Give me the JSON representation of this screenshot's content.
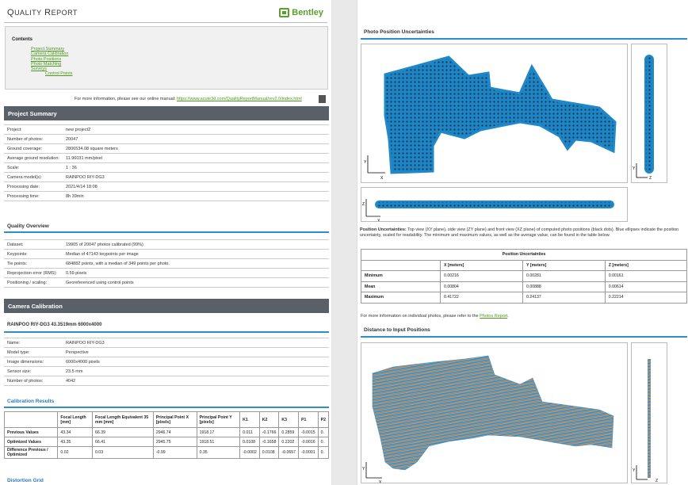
{
  "header": {
    "title_big_Q": "Q",
    "title_rest_1": "UALITY",
    "title_big_R": "R",
    "title_rest_2": "EPORT",
    "brand": "Bentley"
  },
  "contents": {
    "heading": "Contents",
    "items": [
      "Project Summary",
      "Camera Calibration",
      "Photo Positions",
      "Photo Matching",
      "Surveys"
    ],
    "subitem": "Control Points"
  },
  "manual": {
    "text": "For more information, please see our online manual: ",
    "link": "https://www.acute3d.com/QualityReportManual/rev2.0/index.html"
  },
  "project_summary": {
    "heading": "Project Summary",
    "rows": [
      [
        "Project:",
        "new project2"
      ],
      [
        "Number of photos:",
        "20047"
      ],
      [
        "Ground coverage:",
        "2806534.08 square meters"
      ],
      [
        "Average ground resolution:",
        "11.96031 mm/pixel"
      ],
      [
        "Scale:",
        "1 : 36"
      ],
      [
        "Camera model(s):",
        "RAINPOO RIY-DG3"
      ],
      [
        "Processing date:",
        "2021/4/14 18:08"
      ],
      [
        "Processing time:",
        "8h 39min"
      ]
    ]
  },
  "quality_overview": {
    "heading": "Quality Overview",
    "rows": [
      [
        "Dataset:",
        "19905 of 20047 photos calibrated (99%)"
      ],
      [
        "Keypoints:",
        "Median of 47143 keypoints per image"
      ],
      [
        "Tie points:",
        "684882 points, with a median of 349 points per photo."
      ],
      [
        "Reprojection error (RMS):",
        "0.59 pixels"
      ],
      [
        "Positioning / scaling:",
        "Georeferenced using control points"
      ]
    ]
  },
  "camera_calibration": {
    "heading": "Camera Calibration",
    "model_title": "RAINPOO RIY-DG3 43.3519mm 6000x4000",
    "rows": [
      [
        "Name:",
        "RAINPOO RIY-DG3"
      ],
      [
        "Model type:",
        "Perspective"
      ],
      [
        "Image dimensions:",
        "6000x4000 pixels"
      ],
      [
        "Sensor size:",
        "23.5 mm"
      ],
      [
        "Number of photos:",
        "4042"
      ]
    ],
    "results_heading": "Calibration Results",
    "table_headers": [
      "",
      "Focal Length [mm]",
      "Focal Length Equivalent 35 mm [mm]",
      "Principal Point X [pixels]",
      "Principal Point Y [pixels]",
      "K1",
      "K2",
      "K3",
      "P1",
      "P2"
    ],
    "table_rows": [
      [
        "Previous Values",
        "43.34",
        "66.39",
        "2946.74",
        "1918.17",
        "0.011",
        "-0.1766",
        "0.2859",
        "-0.0015",
        "0."
      ],
      [
        "Optimized Values",
        "43.35",
        "66.41",
        "2945.75",
        "1918.51",
        "0.0108",
        "-0.1658",
        "0.2202",
        "-0.0016",
        "0."
      ],
      [
        "Difference Previous / Optimized",
        "0.02",
        "0.03",
        "-0.99",
        "0.35",
        "-0.0002",
        "0.0108",
        "-0.0657",
        "-0.0001",
        "0."
      ]
    ],
    "distortion_heading": "Distortion Grid"
  },
  "photo_position": {
    "heading": "Photo Position Uncertainties",
    "caption_bold": "Position Uncertainties:",
    "caption_text": " Top view (XY plane), side view (ZY plane) and front view (XZ plane) of computed photo positions (black dots). Blue ellipses indicate the position uncertainty, scaled for readability. The minimum and maximum values, as well as the average value, can be found in the table below.",
    "axis_x": "X",
    "axis_y": "Y",
    "axis_z": "Z"
  },
  "uncertainty_table": {
    "title": "Position Uncertainties",
    "headers": [
      "",
      "X [meters]",
      "Y [meters]",
      "Z [meters]"
    ],
    "rows": [
      [
        "Minimum",
        "0.00216",
        "0.00281",
        "0.00161"
      ],
      [
        "Mean",
        "0.00804",
        "0.00888",
        "0.00614"
      ],
      [
        "Maximum",
        "0.41722",
        "0.24137",
        "0.22214"
      ]
    ]
  },
  "more_info": {
    "text": "For more information on individual photos, please refer to the ",
    "link": "Photos Report",
    "end": "."
  },
  "distance": {
    "heading": "Distance to Input Positions"
  },
  "colors": {
    "accent": "#2e8ec9",
    "bar": "#5a6068",
    "brand": "#5aa02c",
    "ellipse": "#1e88c8"
  }
}
